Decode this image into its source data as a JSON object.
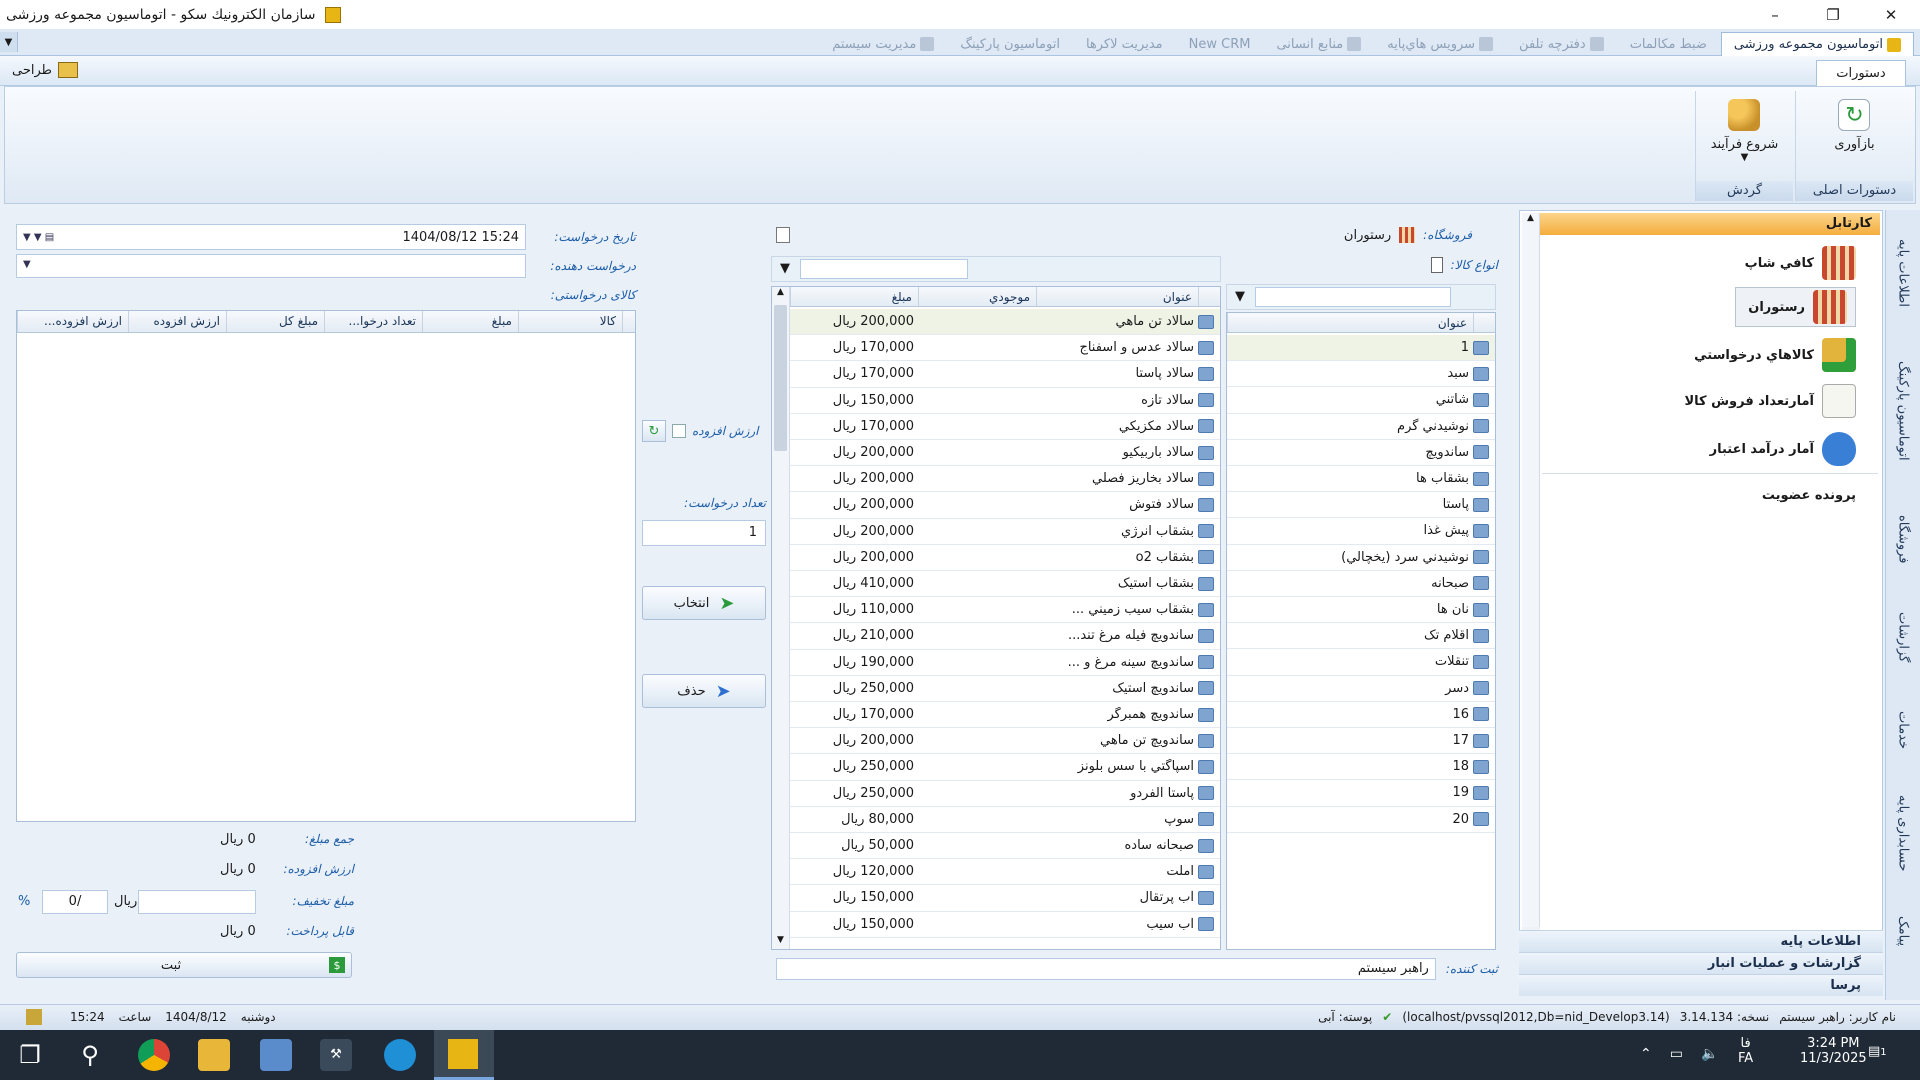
{
  "window": {
    "title": "سازمان الكترونيك سكو - اتوماسيون مجموعه ورزشی"
  },
  "tabs": [
    {
      "label": "اتوماسیون مجموعه ورزشی",
      "active": true
    },
    {
      "label": "ضبط مکالمات"
    },
    {
      "label": "دفترچه تلفن"
    },
    {
      "label": "سرويس هاي‌پايه"
    },
    {
      "label": "منابع انسانی"
    },
    {
      "label": "New CRM"
    },
    {
      "label": "مدیریت لاکرها"
    },
    {
      "label": "اتوماسیون پارکینگ"
    },
    {
      "label": "مدیریت سیستم"
    }
  ],
  "ribbon": {
    "commands_tab": "دستورات",
    "design_label": "طراحی",
    "refresh_label": "بازآوری",
    "start_process_label": "شروع فرآیند",
    "group_main": "دستورات اصلی",
    "group_flow": "گردش"
  },
  "cartable": {
    "title": "کارتابل",
    "items": [
      {
        "label": "کافي شاپ",
        "icon": "shop-icon"
      },
      {
        "label": "رستوران",
        "icon": "restaurant-icon",
        "selected": true
      },
      {
        "label": "کالاهاي درخواستي",
        "icon": "box-check-icon"
      },
      {
        "label": "آمارتعداد فروش کالا",
        "icon": "report-icon"
      },
      {
        "label": "آمار درآمد اعتبار",
        "icon": "money-bag-icon"
      },
      {
        "label": "پرونده عضویت",
        "icon": ""
      }
    ],
    "footer": [
      "اطلاعات پایه",
      "گزارشات و عملیات انبار",
      "پرسا"
    ]
  },
  "side_tabs": [
    "اطلاعات پایه",
    "اتوماسیون پارکینگ",
    "فروشگاه",
    "گزارشات",
    "خدمات",
    "حسابداری پایه",
    "پیامک"
  ],
  "store": {
    "label": "فروشگاه:",
    "value": "رستوران"
  },
  "categories": {
    "label": "انواع كالا:",
    "column": "عنوان",
    "items": [
      "1",
      "سبد",
      "شاتني",
      "نوشيدني گرم",
      "ساندويچ",
      "بشقاب ها",
      "پاستا",
      "پيش غذا",
      "نوشيدني سرد (يخچالي)",
      "صبحانه",
      "نان ها",
      "اقلام تک",
      "تنقلات",
      "دسر",
      "16",
      "17",
      "18",
      "19",
      "20"
    ]
  },
  "products": {
    "columns": {
      "title": "عنوان",
      "stock": "موجودي",
      "price": "مبلغ"
    },
    "items": [
      {
        "title": "سالاد تن ماهي",
        "price": "200,000 ريال"
      },
      {
        "title": "سالاد عدس و اسفناج",
        "price": "170,000 ريال"
      },
      {
        "title": "سالاد پاستا",
        "price": "170,000 ريال"
      },
      {
        "title": "سالاد تازه",
        "price": "150,000 ريال"
      },
      {
        "title": "سالاد مکزيکي",
        "price": "170,000 ريال"
      },
      {
        "title": "سالاد باربيکيو",
        "price": "200,000 ريال"
      },
      {
        "title": "سالاد بخاريز فصلي",
        "price": "200,000 ريال"
      },
      {
        "title": "سالاد فتوش",
        "price": "200,000 ريال"
      },
      {
        "title": "بشقاب انرژي",
        "price": "200,000 ريال"
      },
      {
        "title": "بشقاب o2",
        "price": "200,000 ريال"
      },
      {
        "title": "بشقاب استيک",
        "price": "410,000 ريال"
      },
      {
        "title": "بشقاب سيب زميني ...",
        "price": "110,000 ريال"
      },
      {
        "title": "ساندويچ فيله مرغ تند...",
        "price": "210,000 ريال"
      },
      {
        "title": "ساندويچ سينه مرغ و ...",
        "price": "190,000 ريال"
      },
      {
        "title": "ساندويچ استيک",
        "price": "250,000 ريال"
      },
      {
        "title": "ساندويچ همبرگر",
        "price": "170,000 ريال"
      },
      {
        "title": "ساندويچ تن ماهي",
        "price": "200,000 ريال"
      },
      {
        "title": "اسپاگتي با سس بلونز",
        "price": "250,000 ريال"
      },
      {
        "title": "پاستا آلفردو",
        "price": "250,000 ريال"
      },
      {
        "title": "سوپ",
        "price": "80,000 ريال"
      },
      {
        "title": "صبحانه ساده",
        "price": "50,000 ريال"
      },
      {
        "title": "املت",
        "price": "120,000 ريال"
      },
      {
        "title": "آب پرتقال",
        "price": "150,000 ريال"
      },
      {
        "title": "آب سيب",
        "price": "150,000 ريال"
      }
    ]
  },
  "registrar": {
    "label": "ثبت کننده:",
    "value": "راهبر سیستم"
  },
  "actions": {
    "vat_label": "ارزش افزوده",
    "qty_label": "تعداد درخواست:",
    "qty_value": "1",
    "select_label": "انتخاب",
    "delete_label": "حذف"
  },
  "request": {
    "date_label": "تاریخ درخواست:",
    "date_value": "1404/08/12 15:24",
    "requester_label": "درخواست دهنده:",
    "items_label": "کالای درخواستی:",
    "columns": [
      "کالا",
      "مبلغ",
      "تعداد درخوا...",
      "مبلغ کل",
      "ارزش افزوده",
      "ارزش افزوده..."
    ]
  },
  "totals": {
    "sum_label": "جمع مبلغ:",
    "sum_value": "0 ريال",
    "vat_label": "ارزش افزوده:",
    "vat_value": "0 ريال",
    "discount_label": "مبلغ تخفیف:",
    "discount_unit": "ريال",
    "discount_percent": "0/",
    "percent_sign": "%",
    "payable_label": "قابل پرداخت:",
    "payable_value": "0 ريال",
    "submit_label": "ثبت"
  },
  "status": {
    "user": "نام کاربر: راهبر سیستم",
    "version": "نسخه: 3.14.134",
    "db": "(localhost/pvssql2012,Db=nid_Develop3.14)",
    "theme": "پوسته: آبی",
    "day": "دوشنبه",
    "date": "1404/8/12",
    "time_label": "ساعت",
    "time": "15:24"
  },
  "taskbar": {
    "lang1": "فا",
    "lang2": "FA",
    "clock": "3:24 PM",
    "date": "11/3/2025",
    "notif": "1"
  },
  "colors": {
    "accent": "#1c5da8",
    "cartable_header": "#f4ad3e"
  }
}
